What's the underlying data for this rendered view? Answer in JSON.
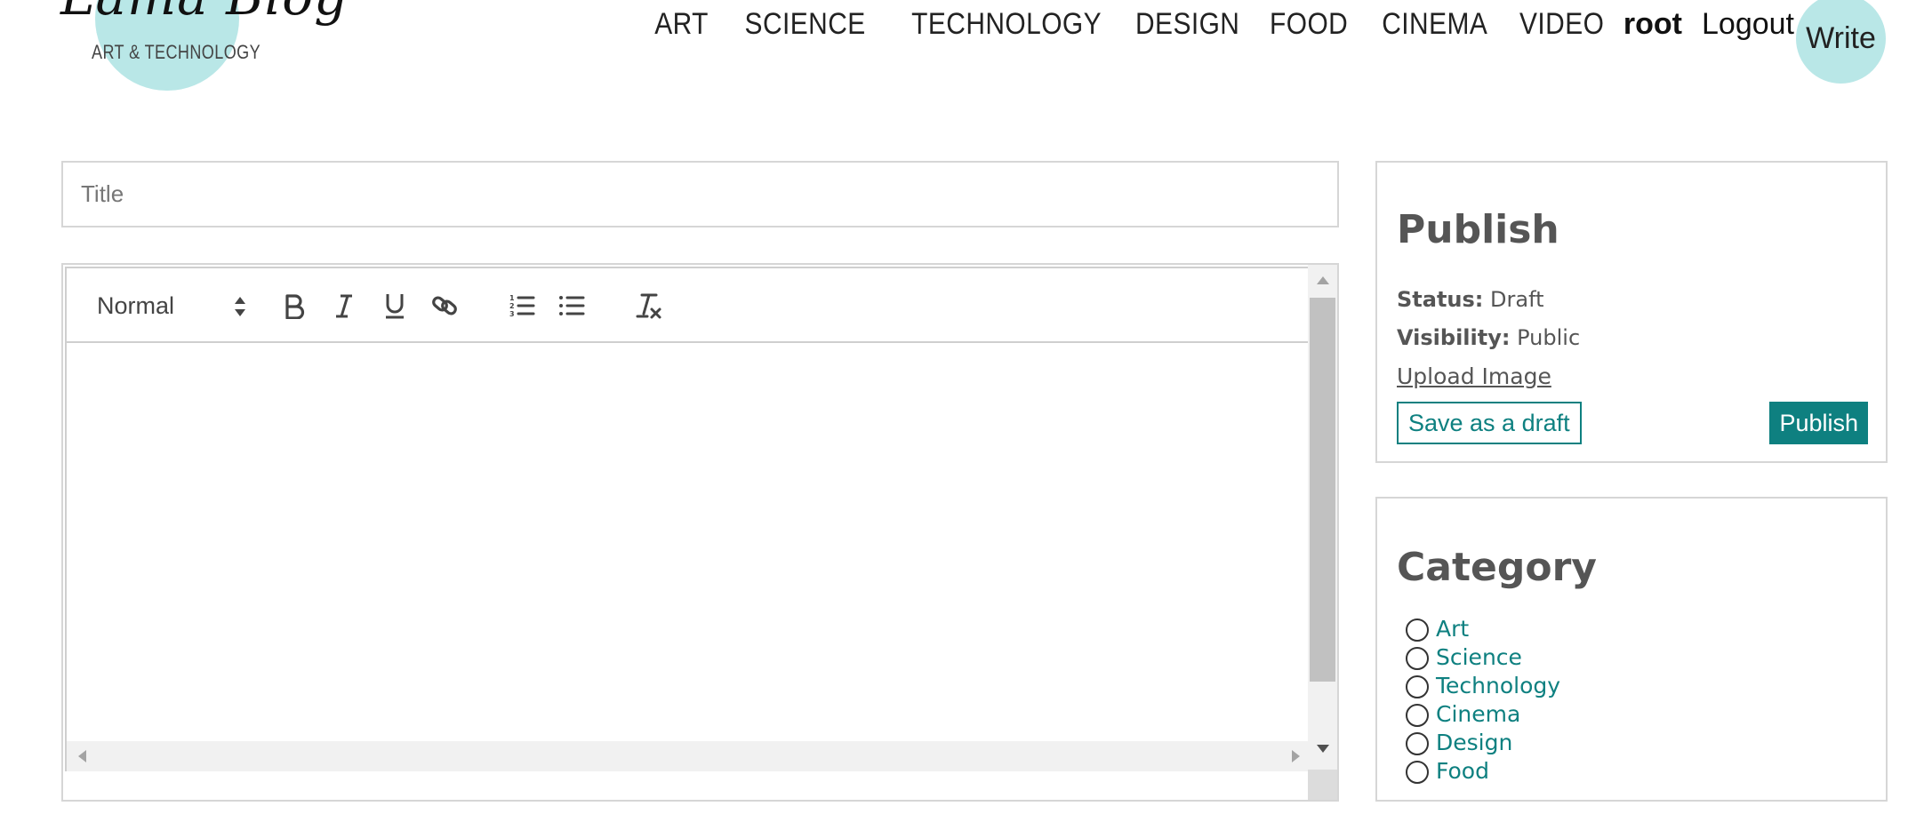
{
  "brand": {
    "name": "Lama Blog",
    "tagline": "ART & TECHNOLOGY",
    "accent_color": "#b9e7e7"
  },
  "nav": {
    "links": [
      "ART",
      "SCIENCE",
      "TECHNOLOGY",
      "DESIGN",
      "FOOD",
      "CINEMA",
      "VIDEO"
    ],
    "username": "root",
    "logout": "Logout",
    "write": "Write"
  },
  "editor": {
    "title_placeholder": "Title",
    "format_picker": "Normal",
    "toolbar_icons": [
      "bold-icon",
      "italic-icon",
      "underline-icon",
      "link-icon",
      "ordered-list-icon",
      "bullet-list-icon",
      "clear-format-icon"
    ],
    "content": ""
  },
  "publish": {
    "heading": "Publish",
    "status_label": "Status:",
    "status_value": "Draft",
    "visibility_label": "Visibility:",
    "visibility_value": "Public",
    "upload_label": "Upload Image",
    "save_draft_label": "Save as a draft",
    "publish_label": "Publish",
    "button_color": "#0e8080"
  },
  "category": {
    "heading": "Category",
    "options": [
      "Art",
      "Science",
      "Technology",
      "Cinema",
      "Design",
      "Food"
    ]
  }
}
